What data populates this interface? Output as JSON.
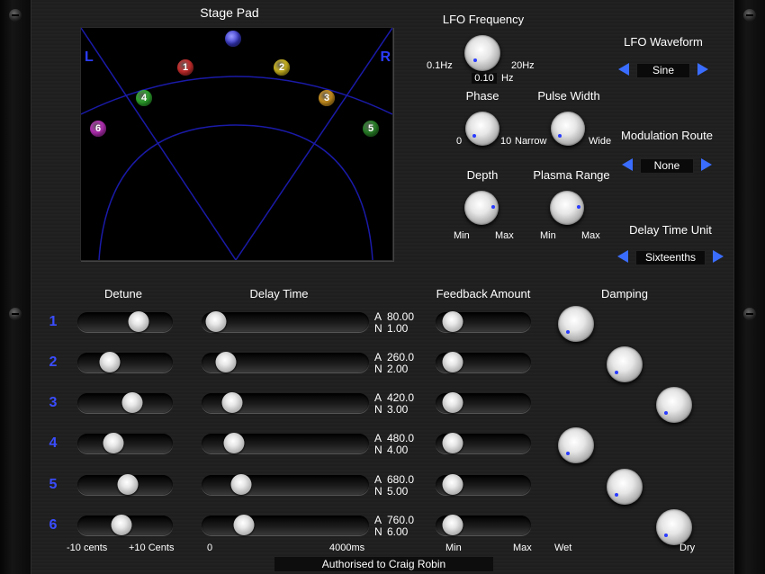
{
  "stage_pad": {
    "title": "Stage Pad",
    "left_label": "L",
    "right_label": "R",
    "voices": [
      {
        "label": "1",
        "color": "#d83030"
      },
      {
        "label": "2",
        "color": "#d8c020"
      },
      {
        "label": "3",
        "color": "#d89a20"
      },
      {
        "label": "4",
        "color": "#30b030"
      },
      {
        "label": "5",
        "color": "#2a8a2a"
      },
      {
        "label": "6",
        "color": "#c030c0"
      }
    ],
    "center_color": "#3a3acc"
  },
  "lfo": {
    "frequency_label": "LFO Frequency",
    "freq_min": "0.1Hz",
    "freq_max": "20Hz",
    "freq_value": "0.10",
    "freq_unit": "Hz",
    "phase_label": "Phase",
    "phase_min": "0",
    "phase_max": "10",
    "pulse_label": "Pulse Width",
    "pulse_min": "Narrow",
    "pulse_max": "Wide",
    "depth_label": "Depth",
    "depth_min": "Min",
    "depth_max": "Max",
    "plasma_label": "Plasma Range",
    "plasma_min": "Min",
    "plasma_max": "Max"
  },
  "selectors": {
    "waveform_label": "LFO Waveform",
    "waveform_value": "Sine",
    "route_label": "Modulation Route",
    "route_value": "None",
    "delay_unit_label": "Delay Time Unit",
    "delay_unit_value": "Sixteenths"
  },
  "columns": {
    "detune": "Detune",
    "delay_time": "Delay Time",
    "feedback": "Feedback Amount",
    "damping": "Damping"
  },
  "rows": [
    {
      "num": "1",
      "detune": 0.68,
      "delay": 0.03,
      "a": "80.00",
      "n": "1.00",
      "feedback": 0.1,
      "damping": 0.0
    },
    {
      "num": "2",
      "detune": 0.3,
      "delay": 0.1,
      "a": "260.0",
      "n": "2.00",
      "feedback": 0.1,
      "damping": 0.45
    },
    {
      "num": "3",
      "detune": 0.6,
      "delay": 0.14,
      "a": "420.0",
      "n": "3.00",
      "feedback": 0.1,
      "damping": 0.9
    },
    {
      "num": "4",
      "detune": 0.35,
      "delay": 0.15,
      "a": "480.0",
      "n": "4.00",
      "feedback": 0.1,
      "damping": 0.0
    },
    {
      "num": "5",
      "detune": 0.54,
      "delay": 0.2,
      "a": "680.0",
      "n": "5.00",
      "feedback": 0.1,
      "damping": 0.45
    },
    {
      "num": "6",
      "detune": 0.45,
      "delay": 0.22,
      "a": "760.0",
      "n": "6.00",
      "feedback": 0.1,
      "damping": 0.9
    }
  ],
  "row_prefix": {
    "a": "A",
    "n": "N"
  },
  "bottom": {
    "detune_min": "-10 cents",
    "detune_max": "+10 Cents",
    "delay_min": "0",
    "delay_max": "4000ms",
    "feedback_min": "Min",
    "feedback_max": "Max",
    "damping_min": "Wet",
    "damping_max": "Dry"
  },
  "footer": "Authorised to Craig Robin"
}
